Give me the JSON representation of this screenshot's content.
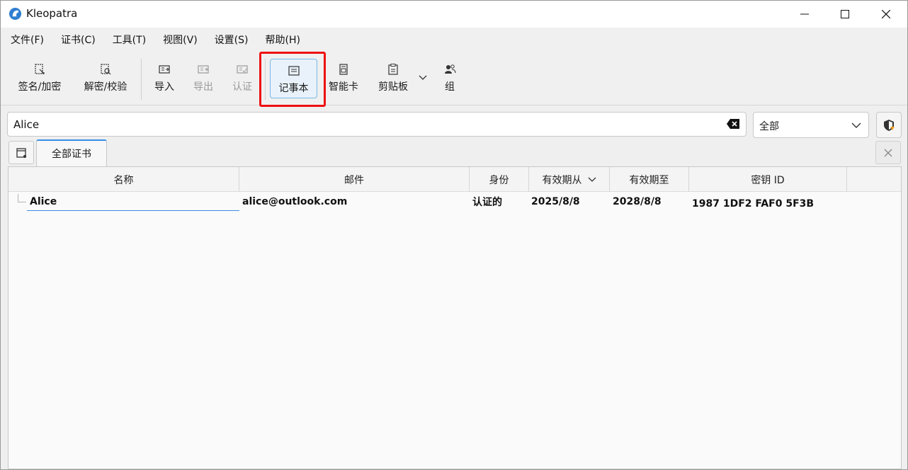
{
  "window": {
    "title": "Kleopatra"
  },
  "menu": {
    "items": [
      "文件(F)",
      "证书(C)",
      "工具(T)",
      "视图(V)",
      "设置(S)",
      "帮助(H)"
    ]
  },
  "toolbar": {
    "sign_encrypt": "签名/加密",
    "decrypt_verify": "解密/校验",
    "import": "导入",
    "export": "导出",
    "certify": "认证",
    "notepad": "记事本",
    "smartcard": "智能卡",
    "clipboard": "剪贴板",
    "group": "组"
  },
  "search": {
    "value": "Alice"
  },
  "filter": {
    "selected": "全部"
  },
  "tabs": [
    {
      "label": "全部证书"
    }
  ],
  "table": {
    "columns": [
      "名称",
      "邮件",
      "身份",
      "有效期从",
      "有效期至",
      "密钥 ID"
    ],
    "rows": [
      {
        "name": "Alice",
        "email": "alice@outlook.com",
        "validity": "认证的",
        "valid_from": "2025/8/8",
        "valid_until": "2028/8/8",
        "key_id": "1987 1DF2 FAF0 5F3B"
      }
    ]
  },
  "colors": {
    "accent": "#3a8ee6",
    "highlight": "#ee1111"
  }
}
